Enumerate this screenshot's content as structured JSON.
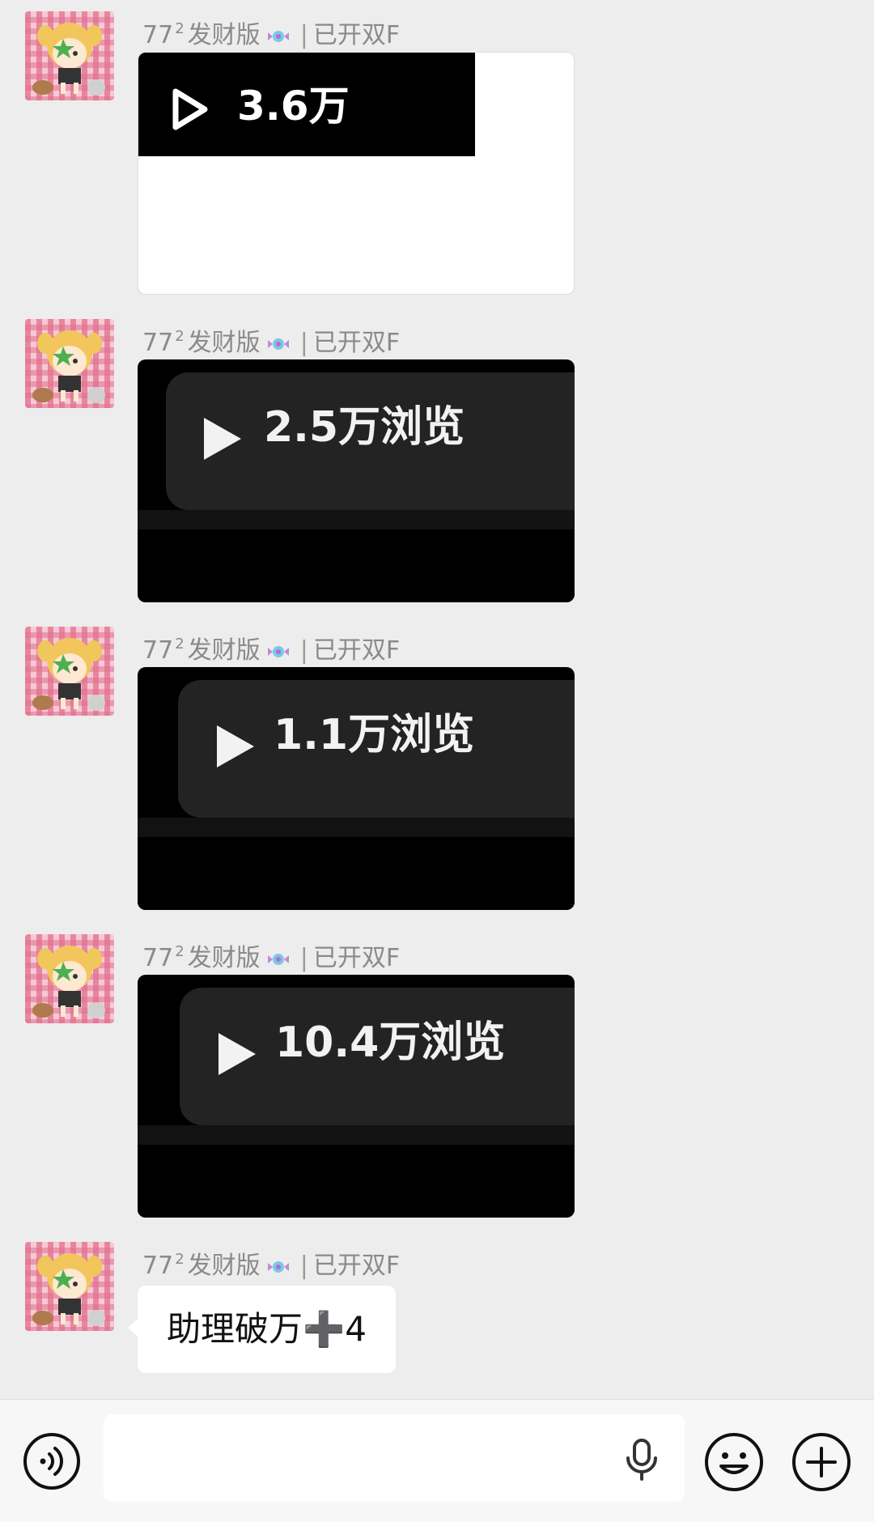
{
  "sender": {
    "name": "77",
    "name_sup": "2",
    "name_suffix": "发财版",
    "separator": "|",
    "status": "已开双F"
  },
  "messages": [
    {
      "type": "video_card_white",
      "views": "3.6万"
    },
    {
      "type": "video_card",
      "views": "2.5万浏览"
    },
    {
      "type": "video_card",
      "views": "1.1万浏览"
    },
    {
      "type": "video_card",
      "views": "10.4万浏览"
    },
    {
      "type": "text",
      "text": "助理破万➕4"
    }
  ],
  "input_bar": {
    "voice_icon": "voice-wave-icon",
    "mic_icon": "microphone-icon",
    "emoji_icon": "smiley-icon",
    "plus_icon": "plus-circle-icon",
    "value": ""
  },
  "colors": {
    "background": "#ededed",
    "bubble": "#ffffff",
    "name_text": "#8a8a8a"
  }
}
